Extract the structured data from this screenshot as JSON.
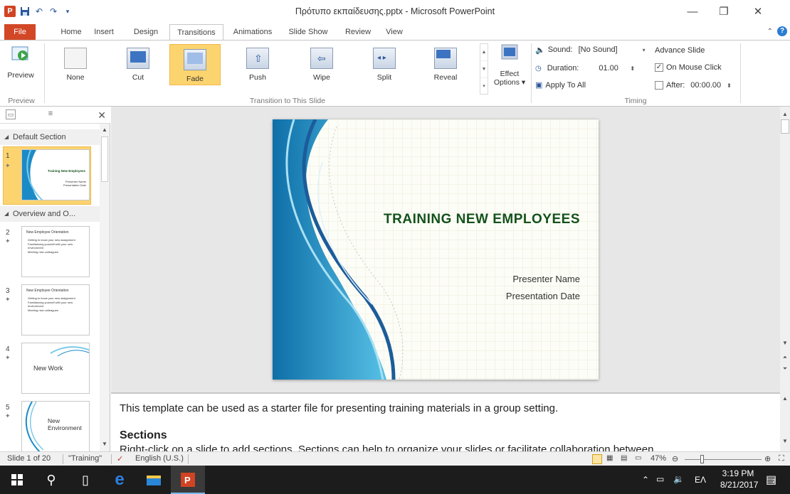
{
  "window": {
    "title": "Πρότυπο εκπαίδευσης.pptx - Microsoft PowerPoint",
    "app_logo": "P",
    "qat_icons": [
      "save-icon",
      "undo-icon",
      "redo-icon",
      "customize-qat-icon"
    ],
    "controls": {
      "minimize": "—",
      "restore": "❐",
      "close": "✕"
    }
  },
  "tabs": [
    {
      "label": "File",
      "state": "file"
    },
    {
      "label": "Home"
    },
    {
      "label": "Insert"
    },
    {
      "label": "Design"
    },
    {
      "label": "Transitions",
      "state": "active"
    },
    {
      "label": "Animations"
    },
    {
      "label": "Slide Show"
    },
    {
      "label": "Review"
    },
    {
      "label": "View"
    }
  ],
  "ribbon": {
    "preview": {
      "button": "Preview",
      "group": "Preview"
    },
    "transitions": {
      "group": "Transition to This Slide",
      "tiles": [
        "None",
        "Cut",
        "Fade",
        "Push",
        "Wipe",
        "Split",
        "Reveal"
      ],
      "selected": "Fade",
      "effect_options_line1": "Effect",
      "effect_options_line2": "Options ▾"
    },
    "timing": {
      "group": "Timing",
      "sound_label": "Sound:",
      "sound_value": "[No Sound]",
      "duration_label": "Duration:",
      "duration_value": "01.00",
      "apply_all": "Apply To All",
      "advance_title": "Advance Slide",
      "on_mouse_click": "On Mouse Click",
      "on_mouse_click_checked": true,
      "after_label": "After:",
      "after_value": "00:00.00",
      "after_checked": false
    }
  },
  "slide_pane": {
    "sections": [
      "Default Section",
      "Overview and O..."
    ],
    "slides": [
      {
        "num": "1",
        "title": "Training New Employees",
        "sub1": "Presenter Name",
        "sub2": "Presentation Date"
      },
      {
        "num": "2",
        "title": "New Employee Orientation",
        "bullets": [
          "Getting to know your new assignment",
          "Familiarizing yourself with your new environment",
          "Meeting new colleagues"
        ]
      },
      {
        "num": "3",
        "title": "New Employee Orientation",
        "bullets": [
          "Getting to know your new assignment",
          "Familiarizing yourself with your new environment",
          "Meeting new colleagues"
        ]
      },
      {
        "num": "4",
        "title": "New Work"
      },
      {
        "num": "5",
        "title": "New Environment"
      }
    ]
  },
  "slide": {
    "title": "TRAINING NEW EMPLOYEES",
    "presenter": "Presenter Name",
    "date": "Presentation Date"
  },
  "notes": {
    "intro": "This template can be used as a starter file for presenting training materials in a group setting.",
    "heading": "Sections",
    "body": "Right-click on a slide to add sections. Sections can help to organize your slides or facilitate collaboration between"
  },
  "status": {
    "slide_info": "Slide 1 of 20",
    "theme": "\"Training\"",
    "language": "English (U.S.)",
    "zoom": "47%"
  },
  "taskbar": {
    "time": "3:19 PM",
    "date": "8/21/2017",
    "lang": "ΕΛ",
    "notifications": "2"
  }
}
